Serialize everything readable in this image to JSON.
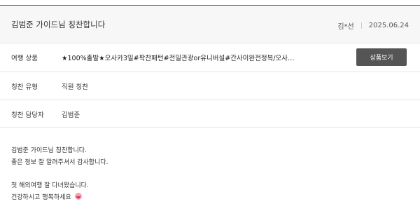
{
  "review": {
    "title": "김범준 가이드님 칭찬합니다",
    "author": "김*선",
    "date": "2025.06.24"
  },
  "details": {
    "product_label": "여행 상품",
    "product_value": "★100%출발★오사카3일#팍찬패턴#전일관광or유니버설#간사이완전정복/오사카,...",
    "product_button": "상품보기",
    "type_label": "칭찬 유형",
    "type_value": "직원 칭찬",
    "staff_label": "칭찬 담당자",
    "staff_value": "김범준"
  },
  "content": {
    "lines": [
      "김범준 가이드님 칭찬합니다.",
      "좋은 정보 잘 알려주셔서 감사합니다.",
      "첫 해외여행 잘 다녀왔습니다.",
      "건강하시고 행복하세요"
    ],
    "emoji_icon": "smiling-face-emoji"
  }
}
